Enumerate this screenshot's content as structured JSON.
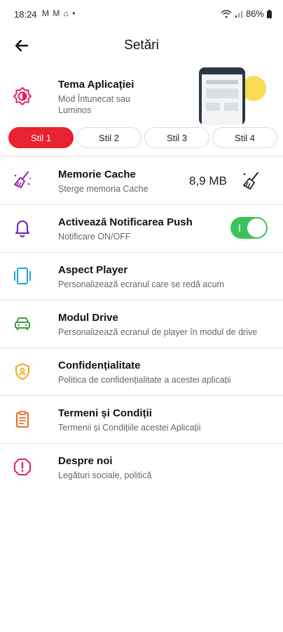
{
  "status_bar": {
    "time": "18:24",
    "left_icons": "M M ⌂ •",
    "battery": "86%"
  },
  "appbar": {
    "title": "Setări",
    "back_icon": "arrow-left-icon"
  },
  "theme": {
    "title": "Tema Aplicației",
    "subtitle": "Mod Întunecat sau Luminos",
    "styles": [
      "Stil 1",
      "Stil 2",
      "Stil 3",
      "Stil 4"
    ],
    "active_style": "Stil 1"
  },
  "rows": {
    "cache": {
      "title": "Memorie Cache",
      "subtitle": "Șterge memoria Cache",
      "size": "8,9 MB"
    },
    "push": {
      "title": "Activează Notificarea Push",
      "subtitle": "Notificare ON/OFF",
      "enabled": true
    },
    "player": {
      "title": "Aspect Player",
      "subtitle": "Personalizează ecranul care se redă acum"
    },
    "drive": {
      "title": "Modul Drive",
      "subtitle": "Personalizează ecranul de player în modul de drive"
    },
    "privacy": {
      "title": "Confidențialitate",
      "subtitle": "Politica de confidențialitate a acestei aplicații"
    },
    "terms": {
      "title": "Termeni și Condiții",
      "subtitle": "Termenii și Condițiile acestei Aplicații"
    },
    "about": {
      "title": "Despre noi",
      "subtitle": "Legături sociale, politică"
    }
  },
  "colors": {
    "accent": "#e8222e",
    "toggle_on": "#3cc25a",
    "cache_icon": "#9b27b0",
    "push_icon": "#6a1fb5",
    "player_icon": "#1aa3d8",
    "drive_icon": "#3b9d45",
    "privacy_icon": "#f2a60c",
    "terms_icon": "#ec6a2a",
    "about_icon": "#e0245e"
  }
}
